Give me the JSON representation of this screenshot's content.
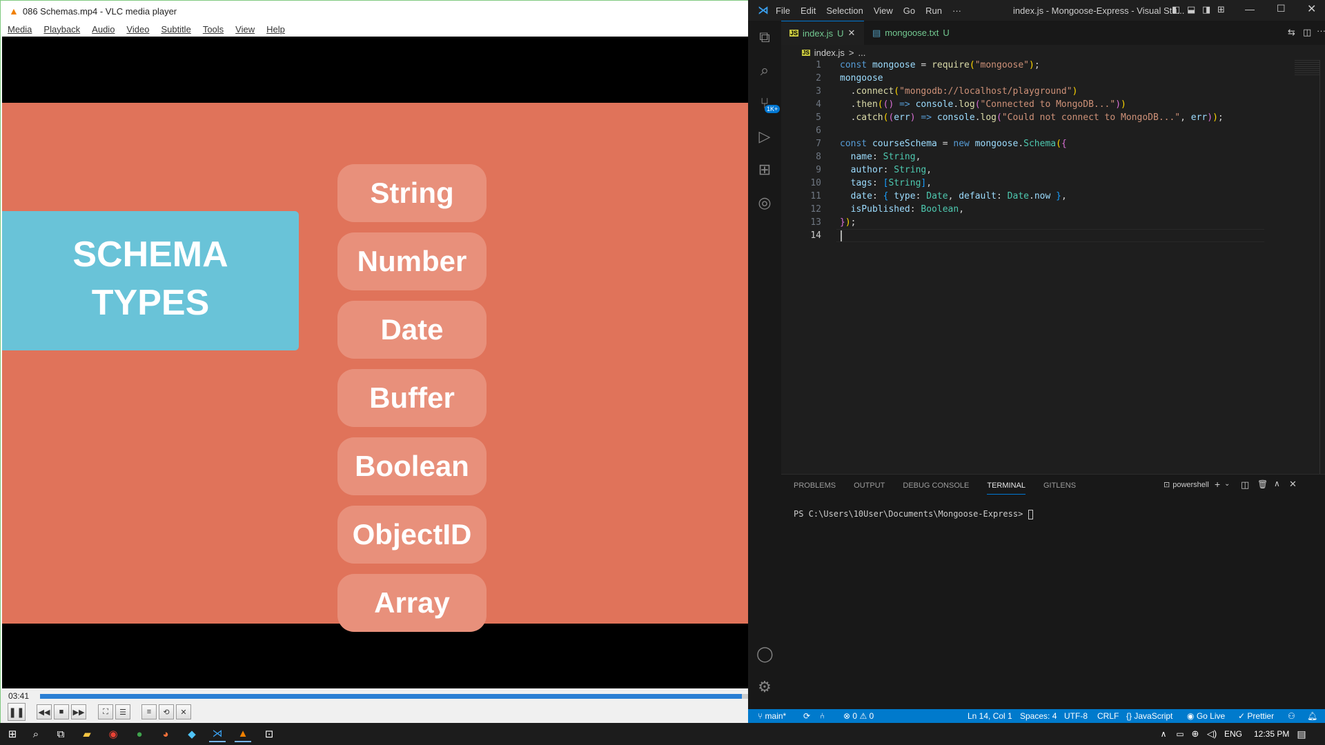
{
  "vlc": {
    "title": "086 Schemas.mp4 - VLC media player",
    "menu": [
      "Media",
      "Playback",
      "Audio",
      "Video",
      "Subtitle",
      "Tools",
      "View",
      "Help"
    ],
    "slide": {
      "heading_line1": "SCHEMA",
      "heading_line2": "TYPES",
      "types": [
        "String",
        "Number",
        "Date",
        "Buffer",
        "Boolean",
        "ObjectID",
        "Array"
      ]
    },
    "time": "03:41",
    "progress": 0.99
  },
  "vscode": {
    "menu": [
      "File",
      "Edit",
      "Selection",
      "View",
      "Go",
      "Run",
      "···"
    ],
    "window_title": "index.js - Mongoose-Express - Visual Stu...",
    "tabs": [
      {
        "name": "index.js",
        "status": "U"
      },
      {
        "name": "mongoose.txt",
        "status": "U"
      }
    ],
    "breadcrumb": [
      "index.js",
      ">",
      "..."
    ],
    "badge": "1K+",
    "line_numbers": [
      "1",
      "2",
      "3",
      "4",
      "5",
      "6",
      "7",
      "8",
      "9",
      "10",
      "11",
      "12",
      "13",
      "14"
    ],
    "panel_tabs": [
      "PROBLEMS",
      "OUTPUT",
      "DEBUG CONSOLE",
      "TERMINAL",
      "GITLENS"
    ],
    "terminal_shell": "powershell",
    "terminal_prompt": "PS C:\\Users\\10User\\Documents\\Mongoose-Express> ",
    "status": {
      "branch": "main*",
      "errors": "0",
      "warnings": "0",
      "cursor": "Ln 14, Col 1",
      "spaces": "Spaces: 4",
      "encoding": "UTF-8",
      "eol": "CRLF",
      "language": "JavaScript",
      "golive": "Go Live",
      "prettier": "Prettier"
    }
  },
  "taskbar": {
    "lang": "ENG",
    "clock": "12:35 PM"
  }
}
